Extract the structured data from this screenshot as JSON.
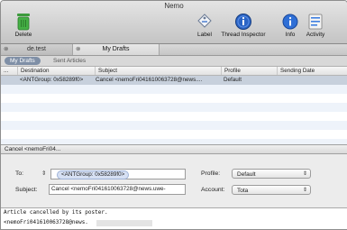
{
  "window": {
    "title": "Nemo"
  },
  "toolbar": {
    "delete_label": "Delete",
    "label_label": "Label",
    "thread_inspector_label": "Thread Inspector",
    "info_label": "Info",
    "activity_label": "Activity"
  },
  "tabs": [
    {
      "label": "de.test",
      "active": false
    },
    {
      "label": "My Drafts",
      "active": true
    }
  ],
  "scope": {
    "my_drafts": "My Drafts",
    "sent_articles": "Sent Articles"
  },
  "list": {
    "columns": [
      "...",
      "Destination",
      "Subject",
      "Profile",
      "Sending Date"
    ],
    "rows": [
      {
        "destination": "<ANTGroup: 0x58289f0>",
        "subject": "Cancel <nemoFri041610063728@news....",
        "profile": "Default",
        "sending_date": ""
      }
    ]
  },
  "split": {
    "text": "Cancel <nemoFri04..."
  },
  "compose": {
    "to_label": "To:",
    "to_token": "<ANTGroup: 0x58289f0>",
    "subject_label": "Subject:",
    "subject_value": "Cancel <nemoFri041610063728@news.uwe-",
    "profile_label": "Profile:",
    "profile_value": "Default",
    "account_label": "Account:",
    "account_value": "Tota"
  },
  "body": {
    "line1": "Article cancelled by its poster.",
    "line2": "<nemoFri041610063728@news."
  }
}
